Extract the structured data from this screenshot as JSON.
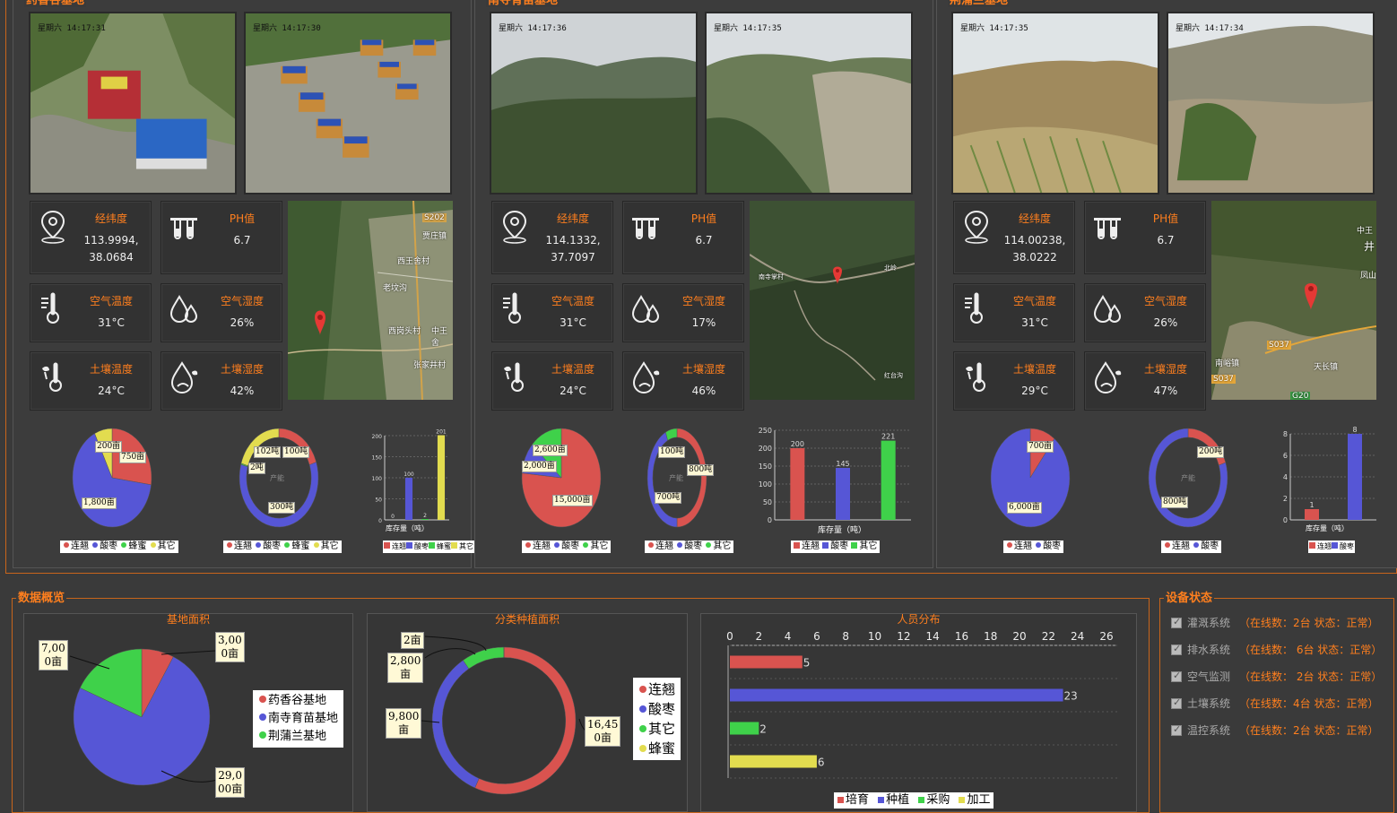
{
  "bases": [
    {
      "title": "药香谷基地",
      "cam1_time": "星期六 14:17:31",
      "cam2_time": "星期六 14:17:30",
      "coord_label": "经纬度",
      "coord_value": "113.9994, 38.0684",
      "ph_label": "PH值",
      "ph_value": "6.7",
      "air_temp_label": "空气温度",
      "air_temp": "31°C",
      "air_hum_label": "空气湿度",
      "air_hum": "26%",
      "soil_temp_label": "土壤温度",
      "soil_temp": "24°C",
      "soil_hum_label": "土壤湿度",
      "soil_hum": "42%",
      "map_labels": [
        "S202",
        "贾庄镇",
        "西王舍村",
        "老坟沟",
        "西岗头村",
        "中王舍",
        "张家井村"
      ],
      "pie_labels": [
        "200亩",
        "750亩",
        "1,800亩"
      ],
      "pie_legend": [
        "连翘",
        "酸枣",
        "蜂蜜",
        "其它"
      ],
      "ring_labels": [
        "102吨",
        "100吨",
        "2吨",
        "产能",
        "300吨"
      ],
      "ring_legend": [
        "连翘",
        "酸枣",
        "蜂蜜",
        "其它"
      ],
      "bar_ticks": [
        "200",
        "150",
        "100",
        "50",
        "0"
      ],
      "bar_values": [
        0,
        100,
        2,
        201
      ],
      "bar_labels": [
        "0",
        "100",
        "2",
        "201"
      ],
      "bar_title": "库存量（吨）",
      "bar_legend": [
        "连翘",
        "酸枣",
        "蜂蜜",
        "其它"
      ]
    },
    {
      "title": "南寺育苗基地",
      "cam1_time": "星期六 14:17:36",
      "cam2_time": "星期六 14:17:35",
      "coord_label": "经纬度",
      "coord_value": "114.1332, 37.7097",
      "ph_label": "PH值",
      "ph_value": "6.7",
      "air_temp_label": "空气温度",
      "air_temp": "31°C",
      "air_hum_label": "空气湿度",
      "air_hum": "17%",
      "soil_temp_label": "土壤温度",
      "soil_temp": "24°C",
      "soil_hum_label": "土壤湿度",
      "soil_hum": "46%",
      "map_labels": [
        "南寺掌村",
        "北岭",
        "红台沟"
      ],
      "pie_labels": [
        "2,600亩",
        "2,000亩",
        "15,000亩"
      ],
      "pie_legend": [
        "连翘",
        "酸枣",
        "其它"
      ],
      "ring_labels": [
        "100吨",
        "800吨",
        "产能",
        "700吨"
      ],
      "ring_legend": [
        "连翘",
        "酸枣",
        "其它"
      ],
      "bar_ticks": [
        "250",
        "200",
        "150",
        "100",
        "50",
        "0"
      ],
      "bar_values": [
        200,
        145,
        221
      ],
      "bar_labels": [
        "200",
        "145",
        "221"
      ],
      "bar_title": "库存量（吨）",
      "bar_legend": [
        "连翘",
        "酸枣",
        "其它"
      ]
    },
    {
      "title": "荆蒲兰基地",
      "cam1_time": "星期六 14:17:35",
      "cam2_time": "星期六 14:17:34",
      "coord_label": "经纬度",
      "coord_value": "114.00238, 38.0222",
      "ph_label": "PH值",
      "ph_value": "6.7",
      "air_temp_label": "空气温度",
      "air_temp": "31°C",
      "air_hum_label": "空气湿度",
      "air_hum": "26%",
      "soil_temp_label": "土壤温度",
      "soil_temp": "29°C",
      "soil_hum_label": "土壤湿度",
      "soil_hum": "47%",
      "map_labels": [
        "中王",
        "井",
        "凤山",
        "S037",
        "南峪镇",
        "天长镇",
        "S037",
        "G20"
      ],
      "pie_labels": [
        "700亩",
        "6,000亩"
      ],
      "pie_legend": [
        "连翘",
        "酸枣"
      ],
      "ring_labels": [
        "200吨",
        "产能",
        "800吨"
      ],
      "ring_legend": [
        "连翘",
        "酸枣"
      ],
      "bar_ticks": [
        "8",
        "6",
        "4",
        "2",
        "0"
      ],
      "bar_values": [
        1,
        8
      ],
      "bar_labels": [
        "1",
        "8"
      ],
      "bar_title": "库存量（吨）",
      "bar_legend": [
        "连翘",
        "酸枣"
      ]
    }
  ],
  "overview": {
    "title": "数据概览",
    "area": {
      "title": "基地面积",
      "labels": [
        "3,00\n0亩",
        "7,00\n0亩",
        "29,0\n00亩"
      ],
      "legend": [
        "药香谷基地",
        "南寺育苗基地",
        "荆蒲兰基地"
      ]
    },
    "plant": {
      "title": "分类种植面积",
      "labels": [
        "2亩",
        "2,800\n亩",
        "9,800\n亩",
        "16,45\n0亩"
      ],
      "legend": [
        "连翘",
        "酸枣",
        "其它",
        "蜂蜜"
      ]
    },
    "people": {
      "title": "人员分布",
      "ticks": [
        "0",
        "2",
        "4",
        "6",
        "8",
        "10",
        "12",
        "14",
        "16",
        "18",
        "20",
        "22",
        "24",
        "26"
      ],
      "legend": [
        "培育",
        "种植",
        "采购",
        "加工"
      ],
      "values": [
        5,
        23,
        2,
        6
      ],
      "value_labels": [
        "5",
        "23",
        "2",
        "6"
      ]
    }
  },
  "devices": {
    "title": "设备状态",
    "items": [
      {
        "name": "灌溉系统",
        "status": "（在线数：2台  状态：正常）"
      },
      {
        "name": "排水系统",
        "status": "（在线数： 6台  状态：正常）"
      },
      {
        "name": "空气监测",
        "status": "（在线数： 2台  状态：正常）"
      },
      {
        "name": "土壤系统",
        "status": "（在线数：4台  状态：正常）"
      },
      {
        "name": "温控系统",
        "status": "（在线数：2台  状态：正常）"
      }
    ]
  },
  "colors": {
    "red": "#d9534f",
    "blue": "#5656d6",
    "green": "#3fd14a",
    "yellow": "#e2dc4f",
    "accent": "#ff7f1e"
  }
}
